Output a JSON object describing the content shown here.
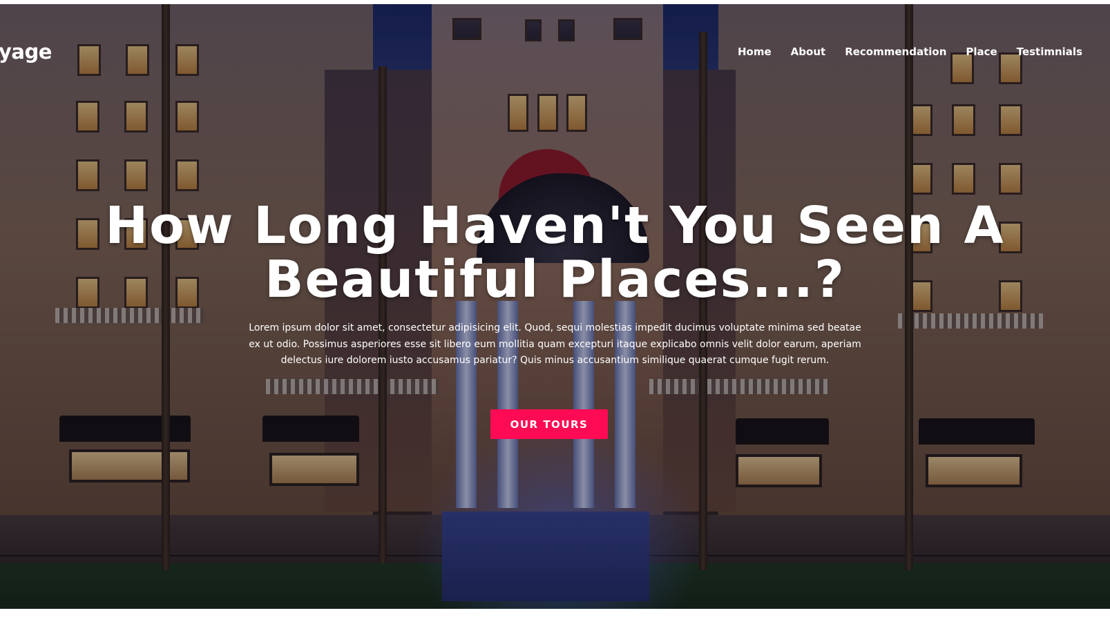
{
  "brand": {
    "logo_text": "yage"
  },
  "nav": {
    "items": [
      {
        "label": "Home"
      },
      {
        "label": "About"
      },
      {
        "label": "Recommendation"
      },
      {
        "label": "Place"
      },
      {
        "label": "Testimnials"
      }
    ]
  },
  "hero": {
    "headline_line1": "How Long Haven't You Seen A",
    "headline_line2": "Beautiful Places...?",
    "description": "Lorem ipsum dolor sit amet, consectetur adipisicing elit. Quod, sequi molestias impedit ducimus voluptate minima sed beatae ex ut odio. Possimus asperiores esse sit libero eum mollitia quam excepturi itaque explicabo omnis velit dolor earum, aperiam delectus iure dolorem iusto accusamus pariatur? Quis minus accusantium similique quaerat cumque fugit rerum.",
    "cta_label": "OUR TOURS",
    "cta_color": "#ff0a54",
    "background_image": "night hotel facade with illuminated fountain"
  }
}
